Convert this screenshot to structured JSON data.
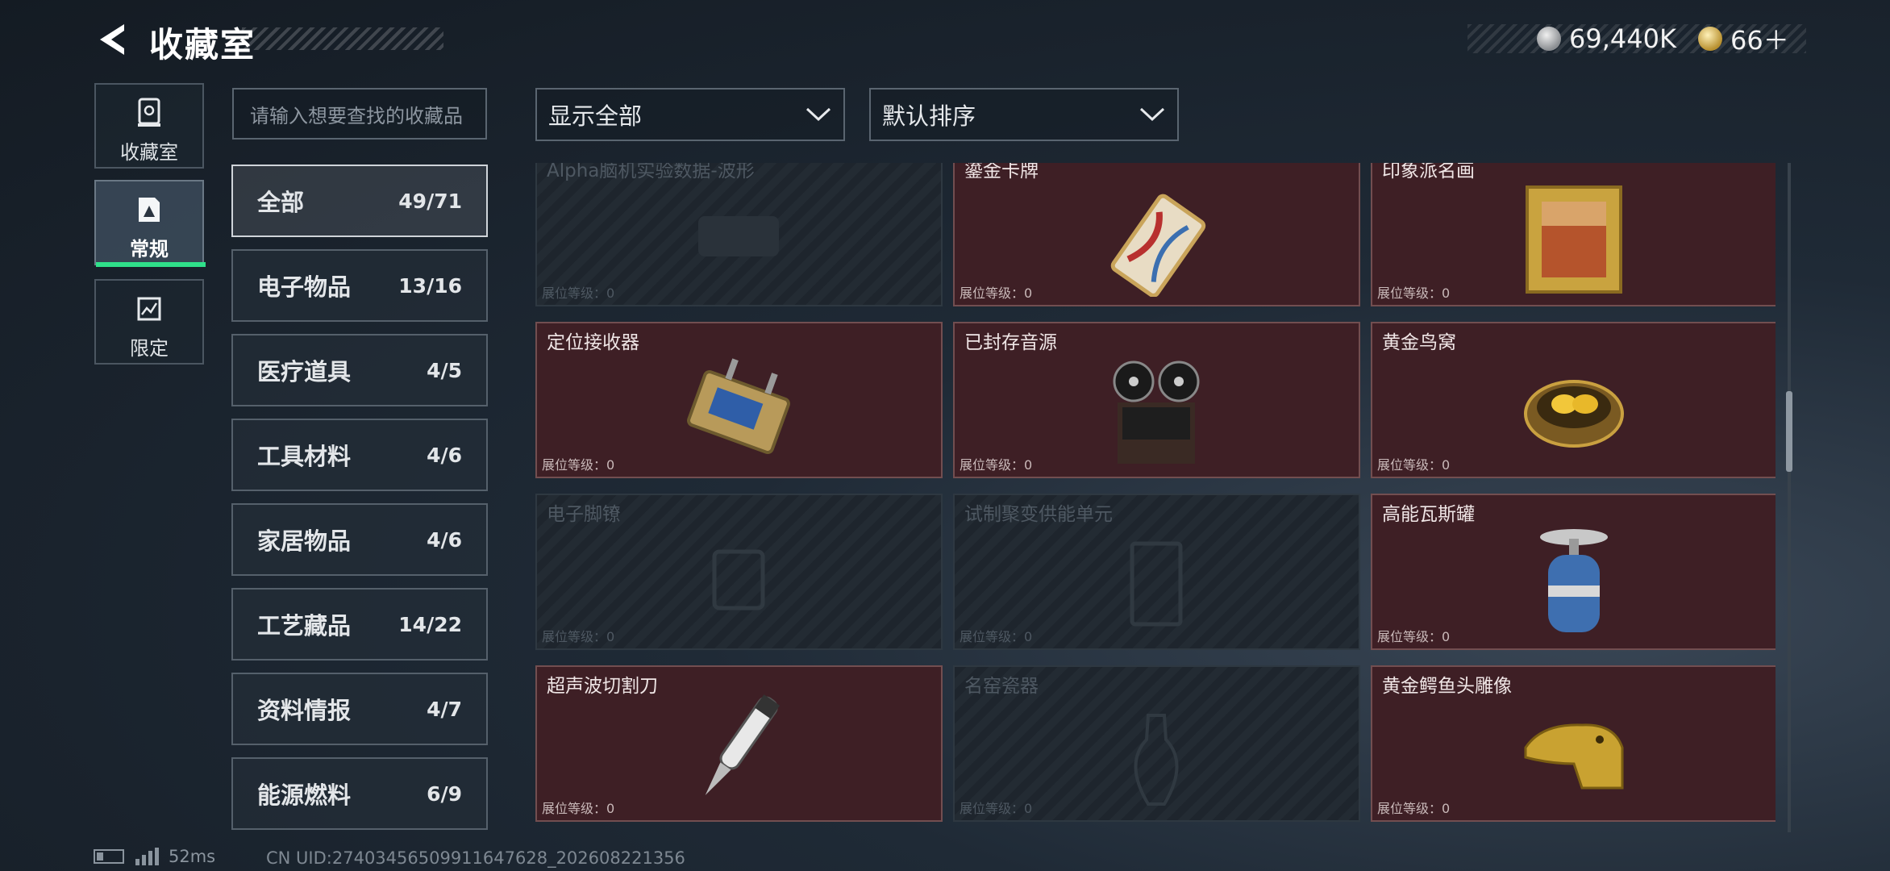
{
  "header": {
    "title": "收藏室"
  },
  "currency": [
    {
      "icon": "silver-coin-icon",
      "value": "69,440K"
    },
    {
      "icon": "gold-token-icon",
      "value": "66＋"
    }
  ],
  "left_tabs": [
    {
      "label": "收藏室",
      "icon": "vault-icon"
    },
    {
      "label": "常规",
      "icon": "gallery-icon",
      "active": true
    },
    {
      "label": "限定",
      "icon": "limited-icon"
    }
  ],
  "search": {
    "placeholder": "请输入想要查找的收藏品"
  },
  "filters": {
    "show": "显示全部",
    "sort": "默认排序"
  },
  "categories": [
    {
      "name": "全部",
      "count": "49/71",
      "active": true
    },
    {
      "name": "电子物品",
      "count": "13/16"
    },
    {
      "name": "医疗道具",
      "count": "4/5"
    },
    {
      "name": "工具材料",
      "count": "4/6"
    },
    {
      "name": "家居物品",
      "count": "4/6"
    },
    {
      "name": "工艺藏品",
      "count": "14/22"
    },
    {
      "name": "资料情报",
      "count": "4/7"
    },
    {
      "name": "能源燃料",
      "count": "6/9"
    }
  ],
  "items": [
    {
      "name": "Alpha脑机实验数据-波形",
      "level": "展位等级：0",
      "owned": false
    },
    {
      "name": "鎏金卡牌",
      "level": "展位等级：0",
      "owned": true
    },
    {
      "name": "印象派名画",
      "level": "展位等级：0",
      "owned": true
    },
    {
      "name": "定位接收器",
      "level": "展位等级：0",
      "owned": true
    },
    {
      "name": "已封存音源",
      "level": "展位等级：0",
      "owned": true
    },
    {
      "name": "黄金鸟窝",
      "level": "展位等级：0",
      "owned": true
    },
    {
      "name": "电子脚镣",
      "level": "展位等级：0",
      "owned": false
    },
    {
      "name": "试制聚变供能单元",
      "level": "展位等级：0",
      "owned": false
    },
    {
      "name": "高能瓦斯罐",
      "level": "展位等级：0",
      "owned": true
    },
    {
      "name": "超声波切割刀",
      "level": "展位等级：0",
      "owned": true
    },
    {
      "name": "名窑瓷器",
      "level": "展位等级：0",
      "owned": false
    },
    {
      "name": "黄金鳄鱼头雕像",
      "level": "展位等级：0",
      "owned": true
    }
  ],
  "status": {
    "ping": "52ms",
    "uid": "CN UID:27403456509911647628_202608221356"
  }
}
